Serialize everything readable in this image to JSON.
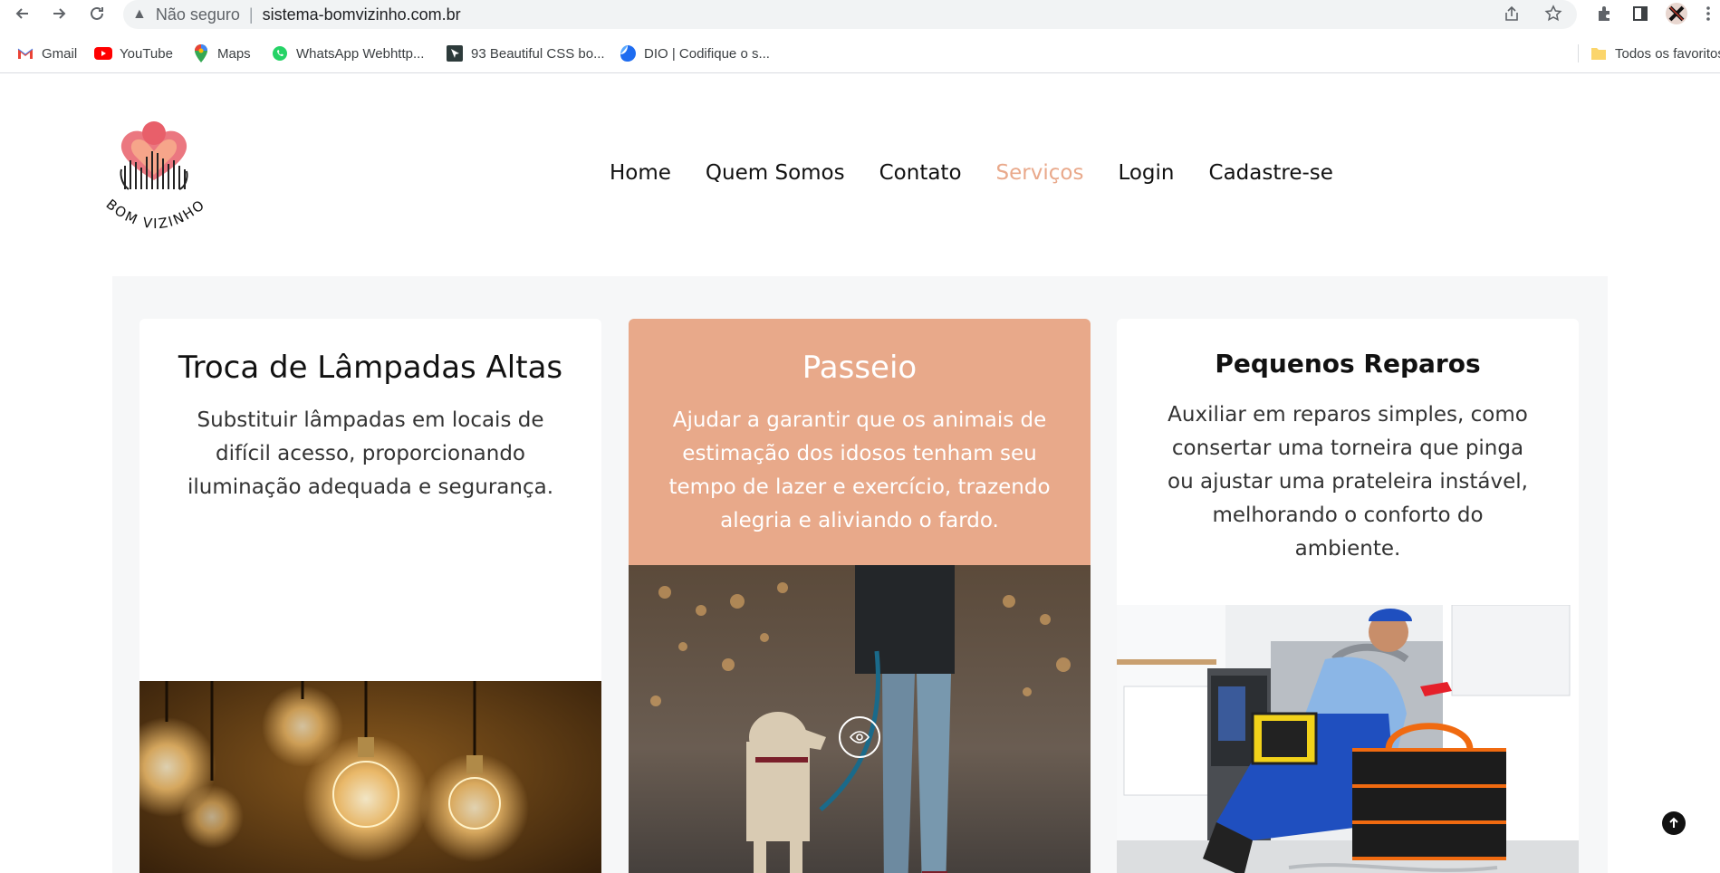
{
  "browser": {
    "security_label": "Não seguro",
    "url": "sistema-bomvizinho.com.br",
    "bookmarks": [
      {
        "label": "Gmail",
        "icon": "gmail-icon"
      },
      {
        "label": "YouTube",
        "icon": "youtube-icon"
      },
      {
        "label": "Maps",
        "icon": "maps-icon"
      },
      {
        "label": "WhatsApp Webhttp...",
        "icon": "whatsapp-icon"
      },
      {
        "label": "93 Beautiful CSS bo...",
        "icon": "css-icon"
      },
      {
        "label": "DIO | Codifique o s...",
        "icon": "dio-icon"
      }
    ],
    "all_bookmarks_label": "Todos os favoritos"
  },
  "site": {
    "logo_text": "BOM VIZINHO",
    "nav": [
      {
        "label": "Home"
      },
      {
        "label": "Quem Somos"
      },
      {
        "label": "Contato"
      },
      {
        "label": "Serviços",
        "active": true
      },
      {
        "label": "Login"
      },
      {
        "label": "Cadastre-se"
      }
    ],
    "accent_color": "#e8a98a"
  },
  "services": [
    {
      "title": "Troca de Lâmpadas Altas",
      "description": "Substituir lâmpadas em locais de difícil acesso, proporcionando iluminação adequada e segurança.",
      "image": "light-bulbs-photo"
    },
    {
      "title": "Passeio",
      "description": "Ajudar a garantir que os animais de estimação dos idosos tenham seu tempo de lazer e exercício, trazendo alegria e aliviando o fardo.",
      "image": "dog-walk-photo",
      "featured": true
    },
    {
      "title": "Pequenos Reparos",
      "description": "Auxiliar em reparos simples, como consertar uma torneira que pinga ou ajustar uma prateleira instável, melhorando o conforto do ambiente.",
      "image": "plumber-photo"
    }
  ]
}
